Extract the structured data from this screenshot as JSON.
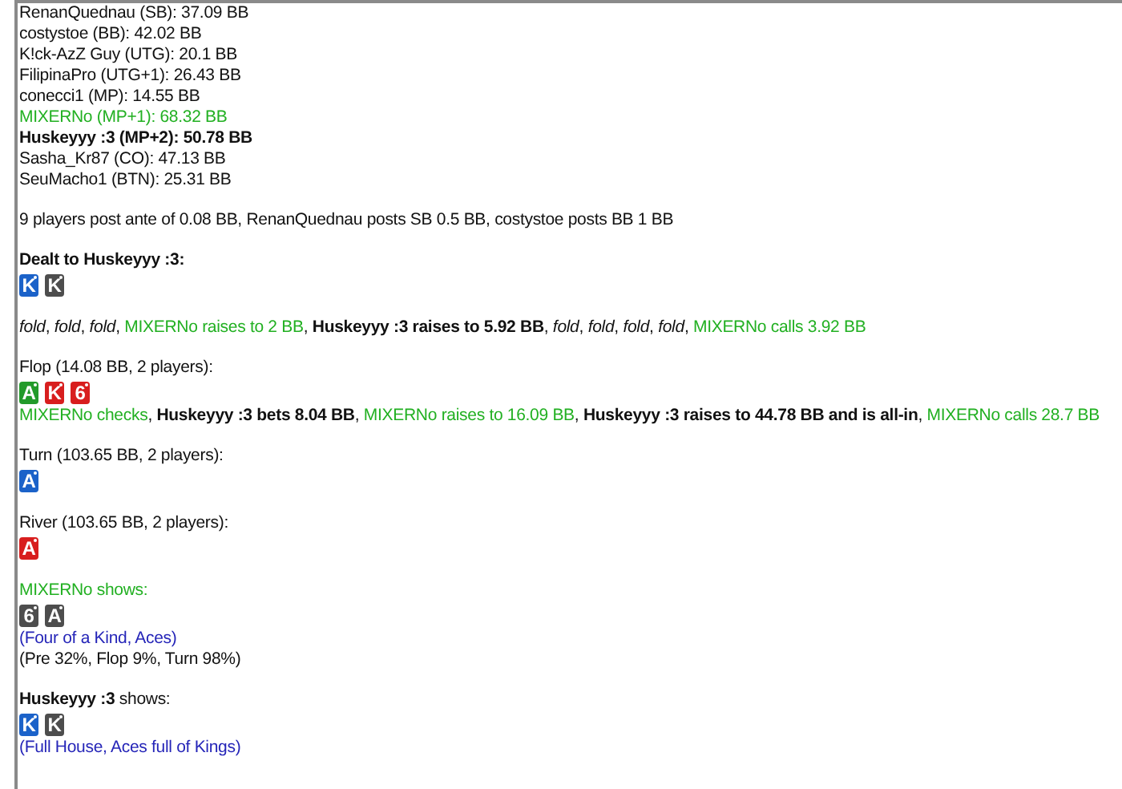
{
  "groups": [
    [
      {
        "kind": "line",
        "parts": [
          {
            "kind": "plain",
            "text": "RenanQuednau (SB): 37.09 BB"
          }
        ]
      },
      {
        "kind": "line",
        "parts": [
          {
            "kind": "plain",
            "text": "costystoe (BB): 42.02 BB"
          }
        ]
      },
      {
        "kind": "line",
        "parts": [
          {
            "kind": "plain",
            "text": "K!ck-AzZ Guy (UTG): 20.1 BB"
          }
        ]
      },
      {
        "kind": "line",
        "parts": [
          {
            "kind": "plain",
            "text": "FilipinaPro (UTG+1): 26.43 BB"
          }
        ]
      },
      {
        "kind": "line",
        "parts": [
          {
            "kind": "plain",
            "text": "conecci1 (MP): 14.55 BB"
          }
        ]
      },
      {
        "kind": "line",
        "parts": [
          {
            "kind": "villain",
            "text": "MIXERNo (MP+1): 68.32 BB"
          }
        ]
      },
      {
        "kind": "line",
        "parts": [
          {
            "kind": "hero",
            "text": "Huskeyyy :3 (MP+2): 50.78 BB"
          }
        ]
      },
      {
        "kind": "line",
        "parts": [
          {
            "kind": "plain",
            "text": "Sasha_Kr87 (CO): 47.13 BB"
          }
        ]
      },
      {
        "kind": "line",
        "parts": [
          {
            "kind": "plain",
            "text": "SeuMacho1 (BTN): 25.31 BB"
          }
        ]
      }
    ],
    [
      {
        "kind": "line",
        "parts": [
          {
            "kind": "plain",
            "text": "9 players post ante of 0.08 BB, RenanQuednau posts SB 0.5 BB, costystoe posts BB 1 BB"
          }
        ]
      }
    ],
    [
      {
        "kind": "line",
        "parts": [
          {
            "kind": "hero",
            "text": "Dealt to Huskeyyy :3:"
          }
        ]
      },
      {
        "kind": "cards",
        "cards": [
          {
            "rank": "K",
            "color": "#1b62c9"
          },
          {
            "rank": "K",
            "color": "#4d4d4d"
          }
        ]
      }
    ],
    [
      {
        "kind": "line",
        "parts": [
          {
            "kind": "fold",
            "text": "fold",
            "after": ", "
          },
          {
            "kind": "fold",
            "text": "fold",
            "after": ", "
          },
          {
            "kind": "fold",
            "text": "fold",
            "after": ", "
          },
          {
            "kind": "villain",
            "text": "MIXERNo raises to 2 BB",
            "after": ", "
          },
          {
            "kind": "hero",
            "text": "Huskeyyy :3 raises to 5.92 BB",
            "after": ", "
          },
          {
            "kind": "fold",
            "text": "fold",
            "after": ", "
          },
          {
            "kind": "fold",
            "text": "fold",
            "after": ", "
          },
          {
            "kind": "fold",
            "text": "fold",
            "after": ", "
          },
          {
            "kind": "fold",
            "text": "fold",
            "after": ", "
          },
          {
            "kind": "villain",
            "text": "MIXERNo calls 3.92 BB"
          }
        ]
      }
    ],
    [
      {
        "kind": "line",
        "parts": [
          {
            "kind": "plain",
            "text": "Flop (14.08 BB, 2 players):"
          }
        ]
      },
      {
        "kind": "cards",
        "cards": [
          {
            "rank": "A",
            "color": "#229a2a"
          },
          {
            "rank": "K",
            "color": "#d81e1e"
          },
          {
            "rank": "6",
            "color": "#d81e1e"
          }
        ]
      },
      {
        "kind": "line",
        "parts": [
          {
            "kind": "villain",
            "text": "MIXERNo checks",
            "after": ", "
          },
          {
            "kind": "hero",
            "text": "Huskeyyy :3 bets 8.04 BB",
            "after": ", "
          },
          {
            "kind": "villain",
            "text": "MIXERNo raises to 16.09 BB",
            "after": ", "
          },
          {
            "kind": "hero",
            "text": "Huskeyyy :3 raises to 44.78 BB and is all-in",
            "after": ", "
          },
          {
            "kind": "villain",
            "text": "MIXERNo calls 28.7 BB"
          }
        ]
      }
    ],
    [
      {
        "kind": "line",
        "parts": [
          {
            "kind": "plain",
            "text": "Turn (103.65 BB, 2 players):"
          }
        ]
      },
      {
        "kind": "cards",
        "cards": [
          {
            "rank": "A",
            "color": "#1b62c9"
          }
        ]
      }
    ],
    [
      {
        "kind": "line",
        "parts": [
          {
            "kind": "plain",
            "text": "River (103.65 BB, 2 players):"
          }
        ]
      },
      {
        "kind": "cards",
        "cards": [
          {
            "rank": "A",
            "color": "#d81e1e"
          }
        ]
      }
    ],
    [
      {
        "kind": "line",
        "parts": [
          {
            "kind": "villain",
            "text": "MIXERNo shows:"
          }
        ]
      },
      {
        "kind": "cards",
        "cards": [
          {
            "rank": "6",
            "color": "#4d4d4d"
          },
          {
            "rank": "A",
            "color": "#4d4d4d"
          }
        ]
      },
      {
        "kind": "line",
        "parts": [
          {
            "kind": "hand",
            "text": "(Four of a Kind, Aces)"
          }
        ]
      },
      {
        "kind": "line",
        "parts": [
          {
            "kind": "plain",
            "text": "(Pre 32%, Flop 9%, Turn 98%)"
          }
        ]
      }
    ],
    [
      {
        "kind": "line",
        "parts": [
          {
            "kind": "hero",
            "text": "Huskeyyy :3"
          },
          {
            "kind": "plain",
            "text": " shows:"
          }
        ]
      },
      {
        "kind": "cards",
        "cards": [
          {
            "rank": "K",
            "color": "#1b62c9"
          },
          {
            "rank": "K",
            "color": "#4d4d4d"
          }
        ]
      },
      {
        "kind": "line",
        "parts": [
          {
            "kind": "hand",
            "text": "(Full House, Aces full of Kings)"
          }
        ]
      }
    ]
  ]
}
